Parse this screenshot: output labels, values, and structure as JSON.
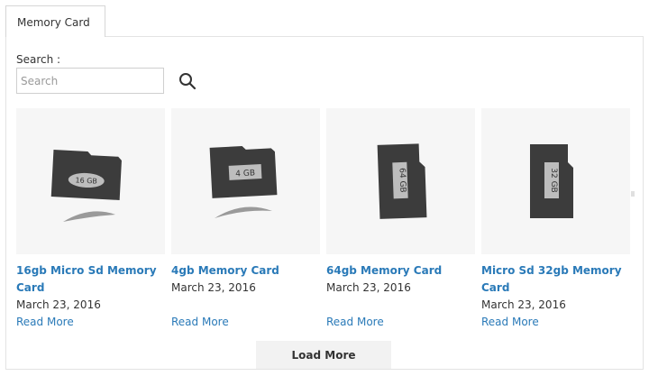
{
  "tab": {
    "label": "Memory Card"
  },
  "search": {
    "label": "Search :",
    "placeholder": "Search",
    "value": ""
  },
  "products": [
    {
      "title": "16gb Micro Sd Memory Card",
      "date": "March 23, 2016",
      "read_more": "Read More",
      "chip_label": "16 GB"
    },
    {
      "title": "4gb Memory Card",
      "date": "March 23, 2016",
      "read_more": "Read More",
      "chip_label": "4 GB"
    },
    {
      "title": "64gb Memory Card",
      "date": "March 23, 2016",
      "read_more": "Read More",
      "chip_label": "64 GB"
    },
    {
      "title": "Micro Sd 32gb Memory Card",
      "date": "March 23, 2016",
      "read_more": "Read More",
      "chip_label": "32 GB"
    }
  ],
  "load_more": {
    "label": "Load More"
  },
  "colors": {
    "link": "#2a7ab8",
    "text": "#333333",
    "border": "#e3e3e3",
    "card_dark": "#3c3c3c"
  }
}
